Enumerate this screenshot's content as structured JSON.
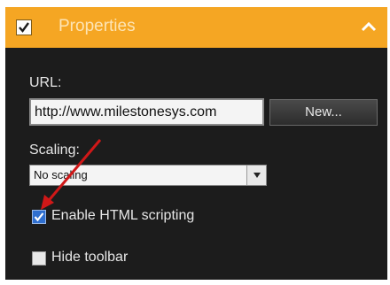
{
  "header": {
    "title": "Properties",
    "checked": true
  },
  "url": {
    "label": "URL:",
    "value": "http://www.milestonesys.com",
    "new_button": "New..."
  },
  "scaling": {
    "label": "Scaling:",
    "value": "No scaling"
  },
  "options": [
    {
      "label": "Enable HTML scripting",
      "checked": true
    },
    {
      "label": "Hide toolbar",
      "checked": false
    }
  ],
  "colors": {
    "accent": "#f5a623",
    "panel": "#1c1c1c",
    "checkbox_on": "#2f6fd0",
    "arrow": "#d01818"
  },
  "icons": {
    "header_check": "checkmark-icon",
    "collapse": "chevron-up-icon",
    "dropdown": "triangle-down-icon",
    "annotation": "red-arrow"
  }
}
